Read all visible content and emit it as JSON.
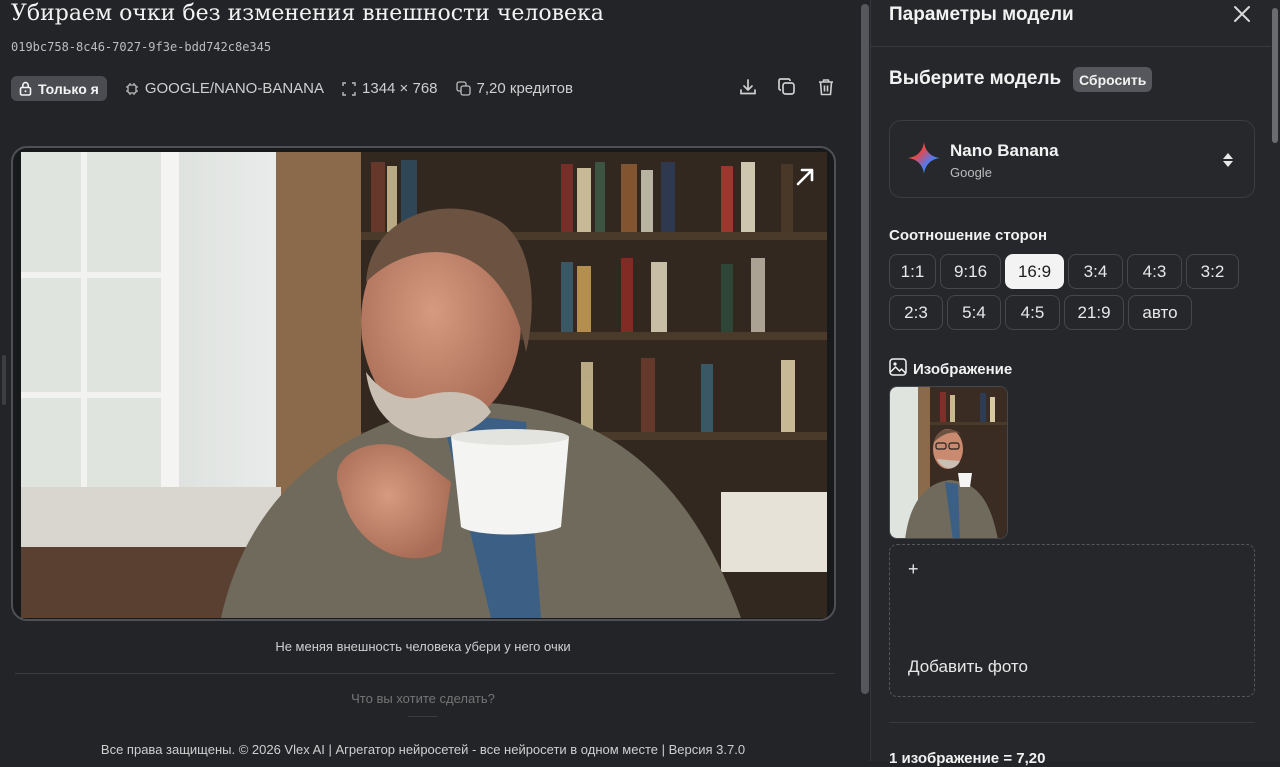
{
  "main": {
    "title": "Убираем очки без изменения внешности человека",
    "id": "019bc758-8c46-7027-9f3e-bdd742c8e345",
    "visibility": "Только я",
    "model": "GOOGLE/NANO-BANANA",
    "resolution": "1344 × 768",
    "credits": "7,20 кредитов",
    "actions": [
      "download-icon",
      "copy-icon",
      "trash-icon"
    ],
    "prompt": "Не меняя внешность человека убери у него очки",
    "ask_placeholder": "Что вы хотите сделать?",
    "footer": "Все права защищены. © 2026 Vlex AI | Агрегатор нейросетей - все нейросети в одном месте | Версия 3.7.0"
  },
  "panel": {
    "title": "Параметры модели",
    "choose_title": "Выберите модель",
    "reset_label": "Сбросить",
    "model": {
      "name": "Nano Banana",
      "vendor": "Google"
    },
    "aspect_label": "Соотношение сторон",
    "aspects": [
      "1:1",
      "9:16",
      "16:9",
      "3:4",
      "4:3",
      "3:2",
      "2:3",
      "5:4",
      "4:5",
      "21:9",
      "авто"
    ],
    "aspect_selected": "16:9",
    "image_label": "Изображение",
    "add_plus": "+",
    "add_label": "Добавить фото",
    "cost": "1 изображение = 7,20"
  },
  "colors": {
    "background": "#222427",
    "panel": "#25272a",
    "active_chip": "#f3f3f3"
  }
}
